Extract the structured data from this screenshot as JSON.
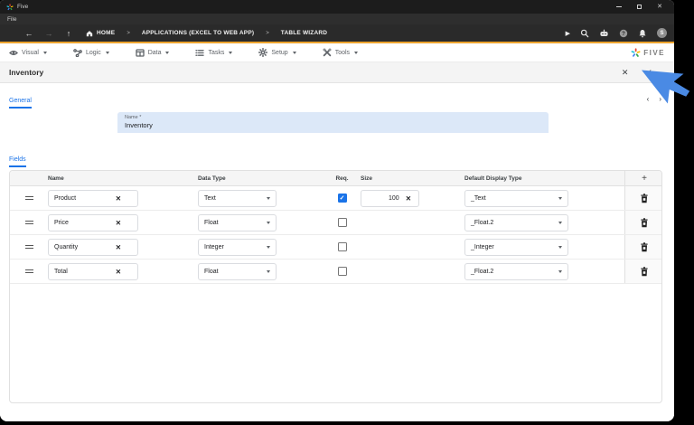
{
  "window": {
    "app_title": "Five"
  },
  "menubar": {
    "file_label": "File"
  },
  "navbar": {
    "breadcrumbs": {
      "home": "HOME",
      "app": "APPLICATIONS (EXCEL TO WEB APP)",
      "wizard": "TABLE WIZARD"
    },
    "separator": ">",
    "avatar_initial": "S"
  },
  "toolbar": {
    "items": {
      "visual": "Visual",
      "logic": "Logic",
      "data": "Data",
      "tasks": "Tasks",
      "setup": "Setup",
      "tools": "Tools"
    },
    "brand": "FIVE"
  },
  "page": {
    "title": "Inventory"
  },
  "tabs": {
    "general": "General",
    "fields": "Fields"
  },
  "form": {
    "name_label": "Name *",
    "name_value": "Inventory"
  },
  "fields_table": {
    "headers": {
      "name": "Name",
      "data_type": "Data Type",
      "req": "Req.",
      "size": "Size",
      "default_display_type": "Default Display Type"
    },
    "rows": [
      {
        "name": "Product",
        "data_type": "Text",
        "required": true,
        "size": "100",
        "default_display_type": "_Text"
      },
      {
        "name": "Price",
        "data_type": "Float",
        "required": false,
        "size": "",
        "default_display_type": "_Float.2"
      },
      {
        "name": "Quantity",
        "data_type": "Integer",
        "required": false,
        "size": "",
        "default_display_type": "_Integer"
      },
      {
        "name": "Total",
        "data_type": "Float",
        "required": false,
        "size": "",
        "default_display_type": "_Float.2"
      }
    ]
  },
  "icons": {
    "close": "✕",
    "check": "✓",
    "clear": "✕",
    "chevron_left": "‹",
    "chevron_right": "›",
    "plus": "+",
    "play": "▶",
    "back": "←",
    "forward": "→",
    "up": "↑"
  },
  "colors": {
    "accent_gold": "#eda42f",
    "accent_blue": "#1a73e8",
    "field_bg": "#dce8f8",
    "cursor_blue": "#4a8ae4",
    "logo_palette": [
      "#ea4335",
      "#fbbc05",
      "#34a853",
      "#4285f4",
      "#26c6da"
    ]
  }
}
